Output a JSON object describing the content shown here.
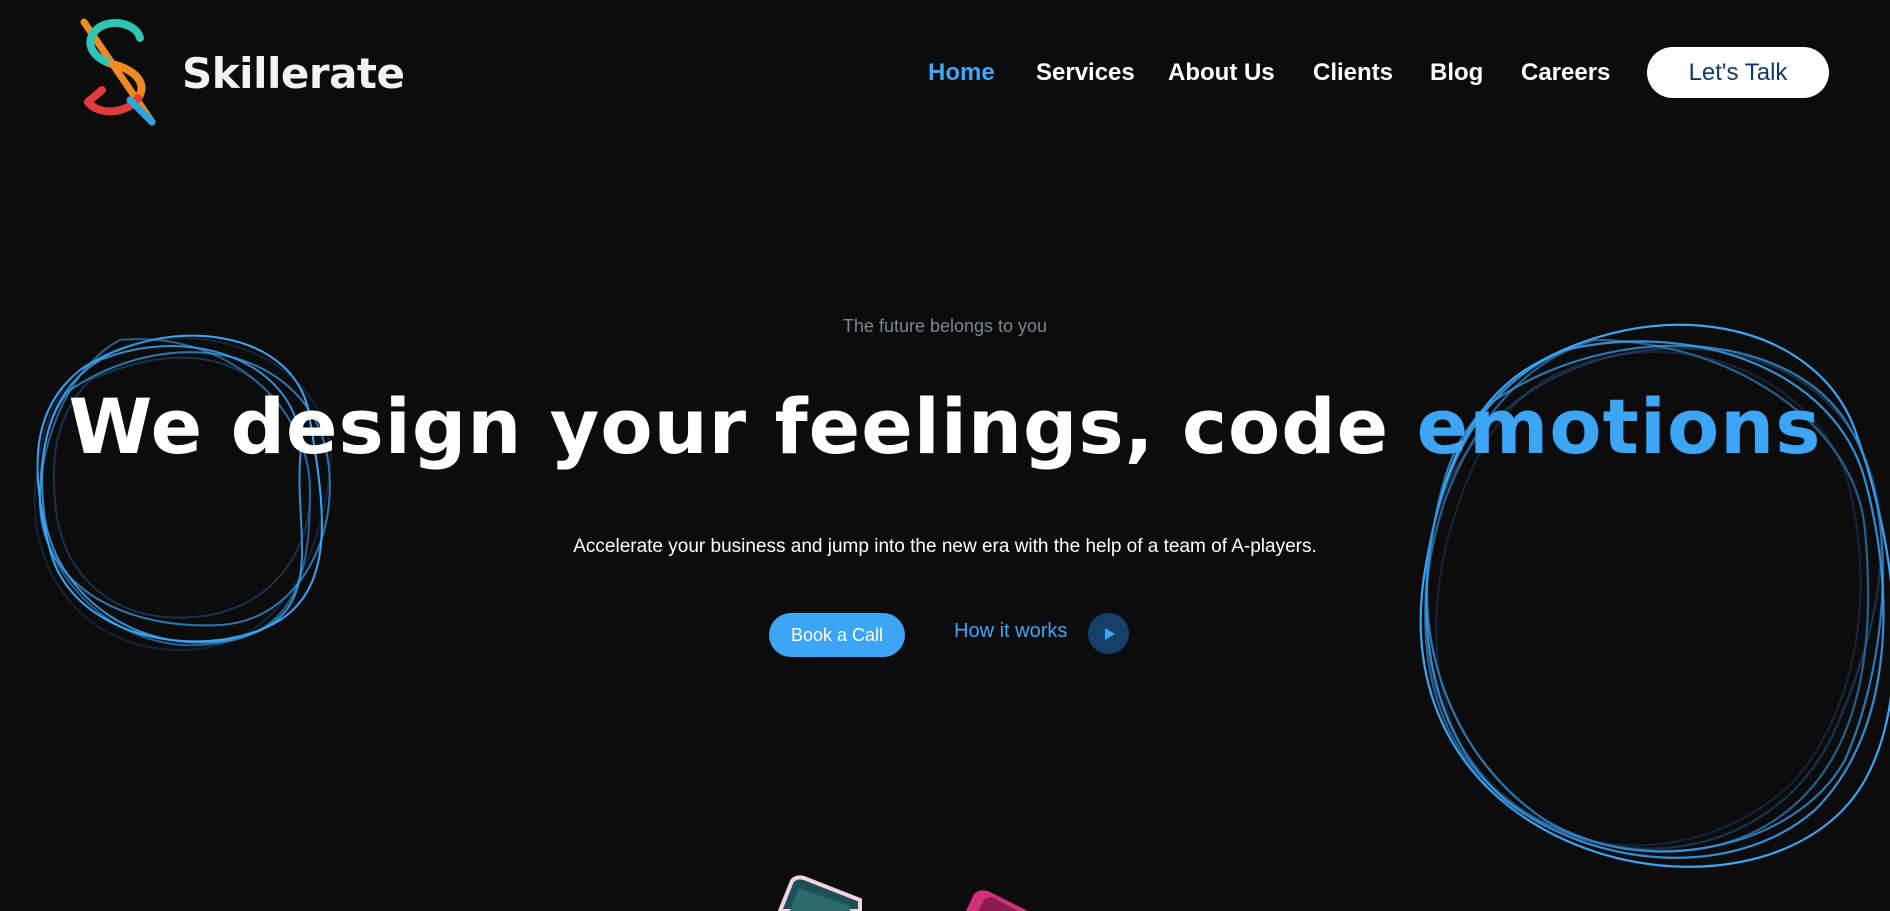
{
  "brand": {
    "name": "Skillerate",
    "colors": {
      "teal": "#2ec4b6",
      "orange": "#f08a24",
      "red": "#e23b3b",
      "blue": "#3da5f5"
    }
  },
  "nav": {
    "items": [
      {
        "label": "Home",
        "active": true
      },
      {
        "label": "Services",
        "active": false
      },
      {
        "label": "About Us",
        "active": false
      },
      {
        "label": "Clients",
        "active": false
      },
      {
        "label": "Blog",
        "active": false
      },
      {
        "label": "Careers",
        "active": false
      }
    ],
    "cta_label": "Let's Talk"
  },
  "hero": {
    "eyebrow": "The future belongs to you",
    "headline_main": "We design your feelings, code ",
    "headline_accent": "emotions",
    "subtitle": "Accelerate your business and jump into the new era with the help of a team of A-players.",
    "primary_button": "Book a Call",
    "secondary_link": "How it works",
    "play_icon": "play-icon"
  },
  "theme": {
    "background": "#0c0c0d",
    "accent": "#3da5f5",
    "muted_text": "#7c8593"
  }
}
